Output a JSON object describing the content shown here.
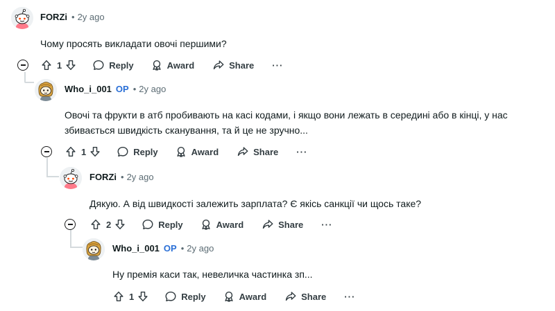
{
  "comments": [
    {
      "author": "FORZi",
      "op": "",
      "time": "2y ago",
      "text": "Чому просять викладати овочі першими?",
      "votes": "1",
      "avatar": "snoo-default"
    },
    {
      "author": "Who_i_001",
      "op": "OP",
      "time": "2y ago",
      "text": "Овочі та фрукти в атб пробивають на касі кодами, і якщо вони лежать в середині або в кінці, у нас збивається швидкість сканування, та й це не зручно...",
      "votes": "1",
      "avatar": "snoo-custom"
    },
    {
      "author": "FORZi",
      "op": "",
      "time": "2y ago",
      "text": "Дякую. А від швидкості залежить зарплата? Є якісь санкції чи щось таке?",
      "votes": "2",
      "avatar": "snoo-default"
    },
    {
      "author": "Who_i_001",
      "op": "OP",
      "time": "2y ago",
      "text": "Ну премія каси так, невеличка частинка зп...",
      "votes": "1",
      "avatar": "snoo-custom"
    }
  ],
  "actions": {
    "reply": "Reply",
    "award": "Award",
    "share": "Share",
    "more": "···"
  },
  "colors": {
    "op_badge": "#2a6fd6",
    "thread_line": "#d4dadd",
    "meta_gray": "#5c6c74"
  }
}
